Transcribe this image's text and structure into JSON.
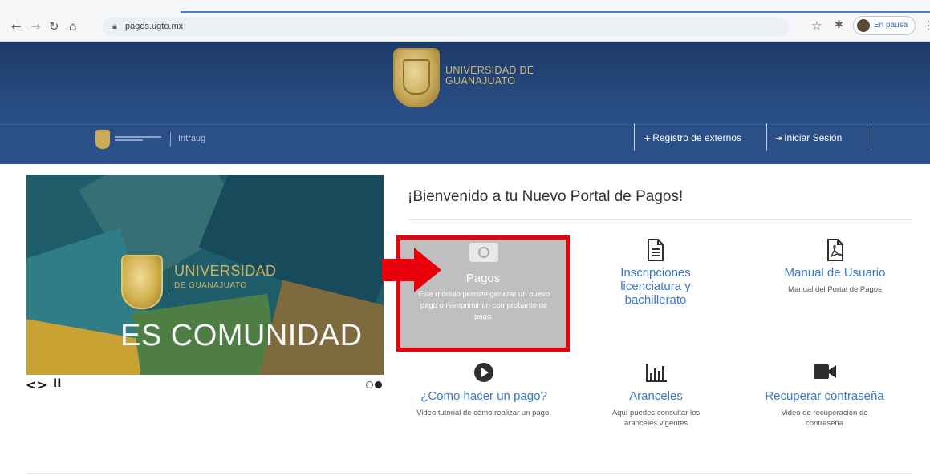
{
  "browser": {
    "url": "pagos.ugto.mx",
    "profile_label": "En pausa",
    "icons": {
      "back": "back-arrow-icon",
      "forward": "forward-arrow-icon",
      "reload": "reload-icon",
      "home": "home-icon",
      "lock": "lock-icon",
      "star": "star-icon",
      "extensions": "puzzle-icon"
    }
  },
  "header": {
    "university_line1": "UNIVERSIDAD DE",
    "university_line2": "GUANAJUATO",
    "intranet_label": "Intraug",
    "nav": {
      "register_icon": "+",
      "register_label": "Registro de externos",
      "login_icon": "⇥",
      "login_label": "Iniciar Sesión"
    },
    "colors": {
      "bar": "#2a4f86",
      "gold": "#c9ab5a"
    }
  },
  "carousel": {
    "slide_university_line1": "UNIVERSIDAD",
    "slide_university_line2": "DE GUANAJUATO",
    "slide_tagline": "ES COMUNIDAD",
    "controls": {
      "prev_next": "<>",
      "pause": "II"
    },
    "slide_count": 2,
    "active_slide": 2
  },
  "main": {
    "welcome_title": "¡Bienvenido a tu Nuevo Portal de Pagos!",
    "highlight_color": "#e8000b",
    "tiles": [
      {
        "icon": "money-icon",
        "title": "Pagos",
        "description": "Este módulo permite generar un nuevo pago o reimprimir un comprobante de pago."
      },
      {
        "icon": "document-icon",
        "glyph": "🗎",
        "title": "Inscripciones licenciatura y bachillerato",
        "description": ""
      },
      {
        "icon": "pdf-icon",
        "glyph": "⎘",
        "title": "Manual de Usuario",
        "description": "Manual del Portal de Pagos"
      },
      {
        "icon": "play-circle-icon",
        "glyph": "▶",
        "title": "¿Como hacer un pago?",
        "description": "Video tutorial de cómo realizar un pago."
      },
      {
        "icon": "bar-chart-icon",
        "glyph": "📊",
        "title": "Aranceles",
        "description": "Aquí puedes consultar los aranceles vigentes"
      },
      {
        "icon": "video-camera-icon",
        "glyph": "■◀",
        "title": "Recuperar contraseña",
        "description": "Video de recuperación de contraseña"
      }
    ]
  }
}
